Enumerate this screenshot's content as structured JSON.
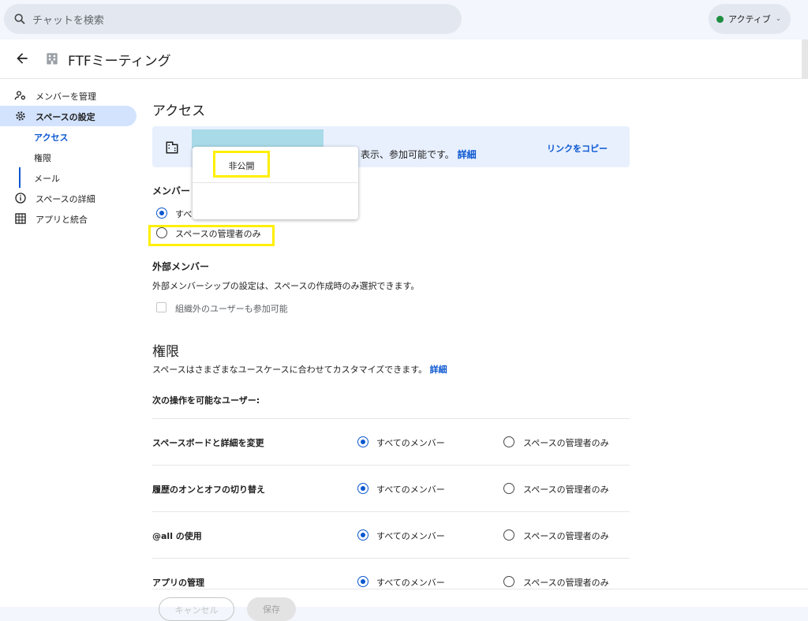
{
  "search": {
    "placeholder": "チャットを検索"
  },
  "status": {
    "label": "アクティブ",
    "color": "#1e8e3e"
  },
  "header": {
    "title": "FTFミーティング"
  },
  "sidebar": {
    "items": [
      {
        "label": "メンバーを管理",
        "icon": "manage-members-icon"
      },
      {
        "label": "スペースの設定",
        "icon": "gear-icon"
      },
      {
        "label": "アクセス"
      },
      {
        "label": "権限"
      },
      {
        "label": "メール"
      },
      {
        "label": "スペースの詳細",
        "icon": "info-icon"
      },
      {
        "label": "アプリと統合",
        "icon": "apps-icon"
      }
    ]
  },
  "access": {
    "title": "アクセス",
    "banner_text": "表示、参加可能です。",
    "banner_link": "詳細",
    "copy_link": "リンクをコピー",
    "members_heading": "メンバー",
    "option_all": "すべ",
    "option_admins": "スペースの管理者のみ"
  },
  "dropdown": {
    "option": "非公開"
  },
  "external": {
    "heading": "外部メンバー",
    "note": "外部メンバーシップの設定は、スペースの作成時のみ選択できます。",
    "checkbox": "組織外のユーザーも参加可能"
  },
  "permissions": {
    "title": "権限",
    "desc": "スペースはさまざまなユースケースに合わせてカスタマイズできます。",
    "desc_link": "詳細",
    "who_label": "次の操作を可能なユーザー:",
    "option_all": "すべてのメンバー",
    "option_admins": "スペースの管理者のみ",
    "rows": [
      {
        "label": "スペースボードと詳細を変更"
      },
      {
        "label": "履歴のオンとオフの切り替え"
      },
      {
        "label": "@all の使用"
      },
      {
        "label": "アプリの管理"
      }
    ]
  },
  "footer": {
    "cancel": "キャンセル",
    "save": "保存"
  }
}
